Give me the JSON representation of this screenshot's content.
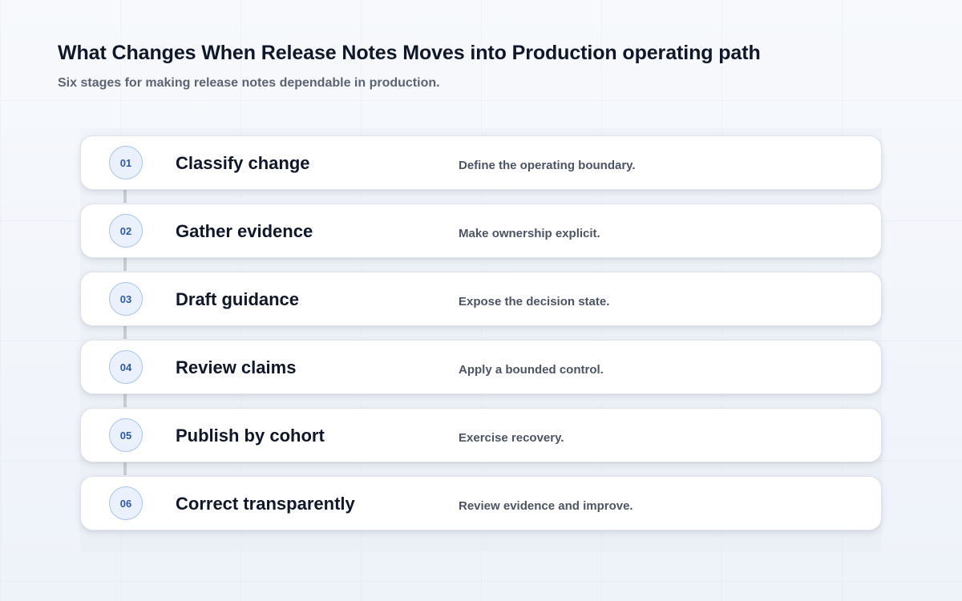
{
  "header": {
    "title": "What Changes When Release Notes Moves into Production operating path",
    "subtitle": "Six stages for making release notes dependable in production."
  },
  "stages": [
    {
      "number": "01",
      "title": "Classify change",
      "description": "Define the operating boundary."
    },
    {
      "number": "02",
      "title": "Gather evidence",
      "description": "Make ownership explicit."
    },
    {
      "number": "03",
      "title": "Draft guidance",
      "description": "Expose the decision state."
    },
    {
      "number": "04",
      "title": "Review claims",
      "description": "Apply a bounded control."
    },
    {
      "number": "05",
      "title": "Publish by cohort",
      "description": "Exercise recovery."
    },
    {
      "number": "06",
      "title": "Correct transparently",
      "description": "Review evidence and improve."
    }
  ],
  "colors": {
    "badge_fill": "#eaf1fd",
    "badge_border": "#a9c3ec",
    "badge_text": "#2e5aa8",
    "title_text": "#0f172a",
    "connector": "#c8ccd3"
  }
}
